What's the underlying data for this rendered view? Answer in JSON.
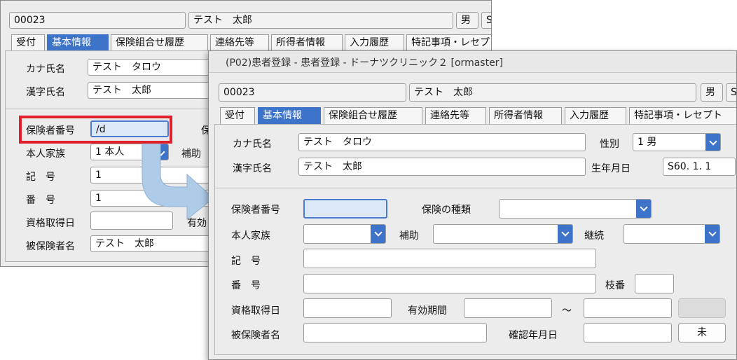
{
  "back": {
    "patient_id": "00023",
    "patient_name": "テスト　太郎",
    "sex_short": "男",
    "partial": "S",
    "tabs": [
      "受付",
      "基本情報",
      "保険組合せ履歴",
      "連絡先等",
      "所得者情報",
      "入力履歴",
      "特記事項・レセプト"
    ],
    "kana_label": "カナ氏名",
    "kana_value": "テスト　タロウ",
    "kanji_label": "漢字氏名",
    "kanji_value": "テスト　太郎",
    "insurer_label": "保険者番号",
    "insurer_value": "/d",
    "insurer_right_partial": "保",
    "family_label": "本人家族",
    "family_value": "1 本人",
    "aid_label": "補助",
    "kigo_label": "記　号",
    "kigo_value": "1",
    "bango_label": "番　号",
    "bango_value": "1",
    "qualify_label": "資格取得日",
    "valid_partial": "有効",
    "insured_label": "被保険者名",
    "insured_value": "テスト　太郎"
  },
  "front": {
    "title": "(P02)患者登録 - 患者登録 - ドーナツクリニック２ [ormaster]",
    "patient_id": "00023",
    "patient_name": "テスト　太郎",
    "sex_short": "男",
    "partial": "S",
    "tabs": [
      "受付",
      "基本情報",
      "保険組合せ履歴",
      "連絡先等",
      "所得者情報",
      "入力履歴",
      "特記事項・レセプト"
    ],
    "kana_label": "カナ氏名",
    "kana_value": "テスト　タロウ",
    "sex_label": "性別",
    "sex_value": "1 男",
    "kanji_label": "漢字氏名",
    "kanji_value": "テスト　太郎",
    "birth_label": "生年月日",
    "birth_value": "S60. 1. 1",
    "insurer_label": "保険者番号",
    "insurer_value": "",
    "insurance_type_label": "保険の種類",
    "family_label": "本人家族",
    "aid_label": "補助",
    "continue_label": "継続",
    "kigo_label": "記　号",
    "bango_label": "番　号",
    "branch_label": "枝番",
    "qualify_label": "資格取得日",
    "valid_label": "有効期間",
    "tilde": "〜",
    "insured_label": "被保険者名",
    "confirm_label": "確認年月日",
    "confirm_button": "未"
  },
  "colors": {
    "accent": "#3d73c9",
    "highlight": "#e0202a",
    "arrow": "#aecbe8"
  }
}
